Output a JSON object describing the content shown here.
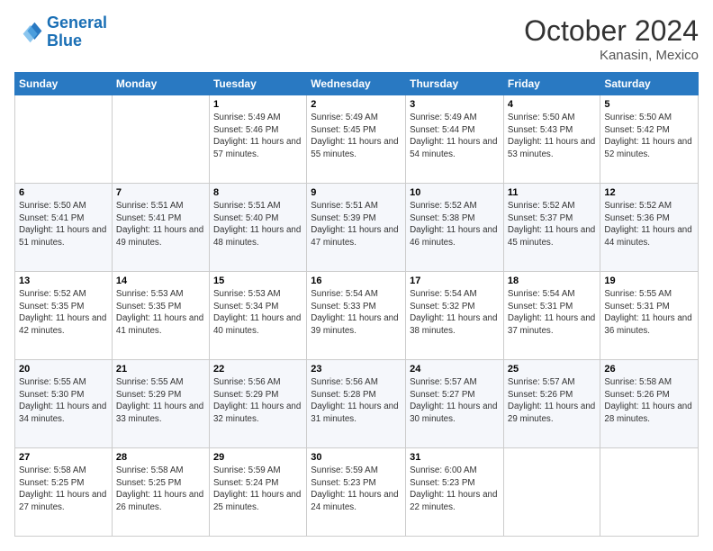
{
  "header": {
    "logo_line1": "General",
    "logo_line2": "Blue",
    "month": "October 2024",
    "location": "Kanasin, Mexico"
  },
  "weekdays": [
    "Sunday",
    "Monday",
    "Tuesday",
    "Wednesday",
    "Thursday",
    "Friday",
    "Saturday"
  ],
  "weeks": [
    [
      {
        "day": "",
        "info": ""
      },
      {
        "day": "",
        "info": ""
      },
      {
        "day": "1",
        "info": "Sunrise: 5:49 AM\nSunset: 5:46 PM\nDaylight: 11 hours and 57 minutes."
      },
      {
        "day": "2",
        "info": "Sunrise: 5:49 AM\nSunset: 5:45 PM\nDaylight: 11 hours and 55 minutes."
      },
      {
        "day": "3",
        "info": "Sunrise: 5:49 AM\nSunset: 5:44 PM\nDaylight: 11 hours and 54 minutes."
      },
      {
        "day": "4",
        "info": "Sunrise: 5:50 AM\nSunset: 5:43 PM\nDaylight: 11 hours and 53 minutes."
      },
      {
        "day": "5",
        "info": "Sunrise: 5:50 AM\nSunset: 5:42 PM\nDaylight: 11 hours and 52 minutes."
      }
    ],
    [
      {
        "day": "6",
        "info": "Sunrise: 5:50 AM\nSunset: 5:41 PM\nDaylight: 11 hours and 51 minutes."
      },
      {
        "day": "7",
        "info": "Sunrise: 5:51 AM\nSunset: 5:41 PM\nDaylight: 11 hours and 49 minutes."
      },
      {
        "day": "8",
        "info": "Sunrise: 5:51 AM\nSunset: 5:40 PM\nDaylight: 11 hours and 48 minutes."
      },
      {
        "day": "9",
        "info": "Sunrise: 5:51 AM\nSunset: 5:39 PM\nDaylight: 11 hours and 47 minutes."
      },
      {
        "day": "10",
        "info": "Sunrise: 5:52 AM\nSunset: 5:38 PM\nDaylight: 11 hours and 46 minutes."
      },
      {
        "day": "11",
        "info": "Sunrise: 5:52 AM\nSunset: 5:37 PM\nDaylight: 11 hours and 45 minutes."
      },
      {
        "day": "12",
        "info": "Sunrise: 5:52 AM\nSunset: 5:36 PM\nDaylight: 11 hours and 44 minutes."
      }
    ],
    [
      {
        "day": "13",
        "info": "Sunrise: 5:52 AM\nSunset: 5:35 PM\nDaylight: 11 hours and 42 minutes."
      },
      {
        "day": "14",
        "info": "Sunrise: 5:53 AM\nSunset: 5:35 PM\nDaylight: 11 hours and 41 minutes."
      },
      {
        "day": "15",
        "info": "Sunrise: 5:53 AM\nSunset: 5:34 PM\nDaylight: 11 hours and 40 minutes."
      },
      {
        "day": "16",
        "info": "Sunrise: 5:54 AM\nSunset: 5:33 PM\nDaylight: 11 hours and 39 minutes."
      },
      {
        "day": "17",
        "info": "Sunrise: 5:54 AM\nSunset: 5:32 PM\nDaylight: 11 hours and 38 minutes."
      },
      {
        "day": "18",
        "info": "Sunrise: 5:54 AM\nSunset: 5:31 PM\nDaylight: 11 hours and 37 minutes."
      },
      {
        "day": "19",
        "info": "Sunrise: 5:55 AM\nSunset: 5:31 PM\nDaylight: 11 hours and 36 minutes."
      }
    ],
    [
      {
        "day": "20",
        "info": "Sunrise: 5:55 AM\nSunset: 5:30 PM\nDaylight: 11 hours and 34 minutes."
      },
      {
        "day": "21",
        "info": "Sunrise: 5:55 AM\nSunset: 5:29 PM\nDaylight: 11 hours and 33 minutes."
      },
      {
        "day": "22",
        "info": "Sunrise: 5:56 AM\nSunset: 5:29 PM\nDaylight: 11 hours and 32 minutes."
      },
      {
        "day": "23",
        "info": "Sunrise: 5:56 AM\nSunset: 5:28 PM\nDaylight: 11 hours and 31 minutes."
      },
      {
        "day": "24",
        "info": "Sunrise: 5:57 AM\nSunset: 5:27 PM\nDaylight: 11 hours and 30 minutes."
      },
      {
        "day": "25",
        "info": "Sunrise: 5:57 AM\nSunset: 5:26 PM\nDaylight: 11 hours and 29 minutes."
      },
      {
        "day": "26",
        "info": "Sunrise: 5:58 AM\nSunset: 5:26 PM\nDaylight: 11 hours and 28 minutes."
      }
    ],
    [
      {
        "day": "27",
        "info": "Sunrise: 5:58 AM\nSunset: 5:25 PM\nDaylight: 11 hours and 27 minutes."
      },
      {
        "day": "28",
        "info": "Sunrise: 5:58 AM\nSunset: 5:25 PM\nDaylight: 11 hours and 26 minutes."
      },
      {
        "day": "29",
        "info": "Sunrise: 5:59 AM\nSunset: 5:24 PM\nDaylight: 11 hours and 25 minutes."
      },
      {
        "day": "30",
        "info": "Sunrise: 5:59 AM\nSunset: 5:23 PM\nDaylight: 11 hours and 24 minutes."
      },
      {
        "day": "31",
        "info": "Sunrise: 6:00 AM\nSunset: 5:23 PM\nDaylight: 11 hours and 22 minutes."
      },
      {
        "day": "",
        "info": ""
      },
      {
        "day": "",
        "info": ""
      }
    ]
  ]
}
